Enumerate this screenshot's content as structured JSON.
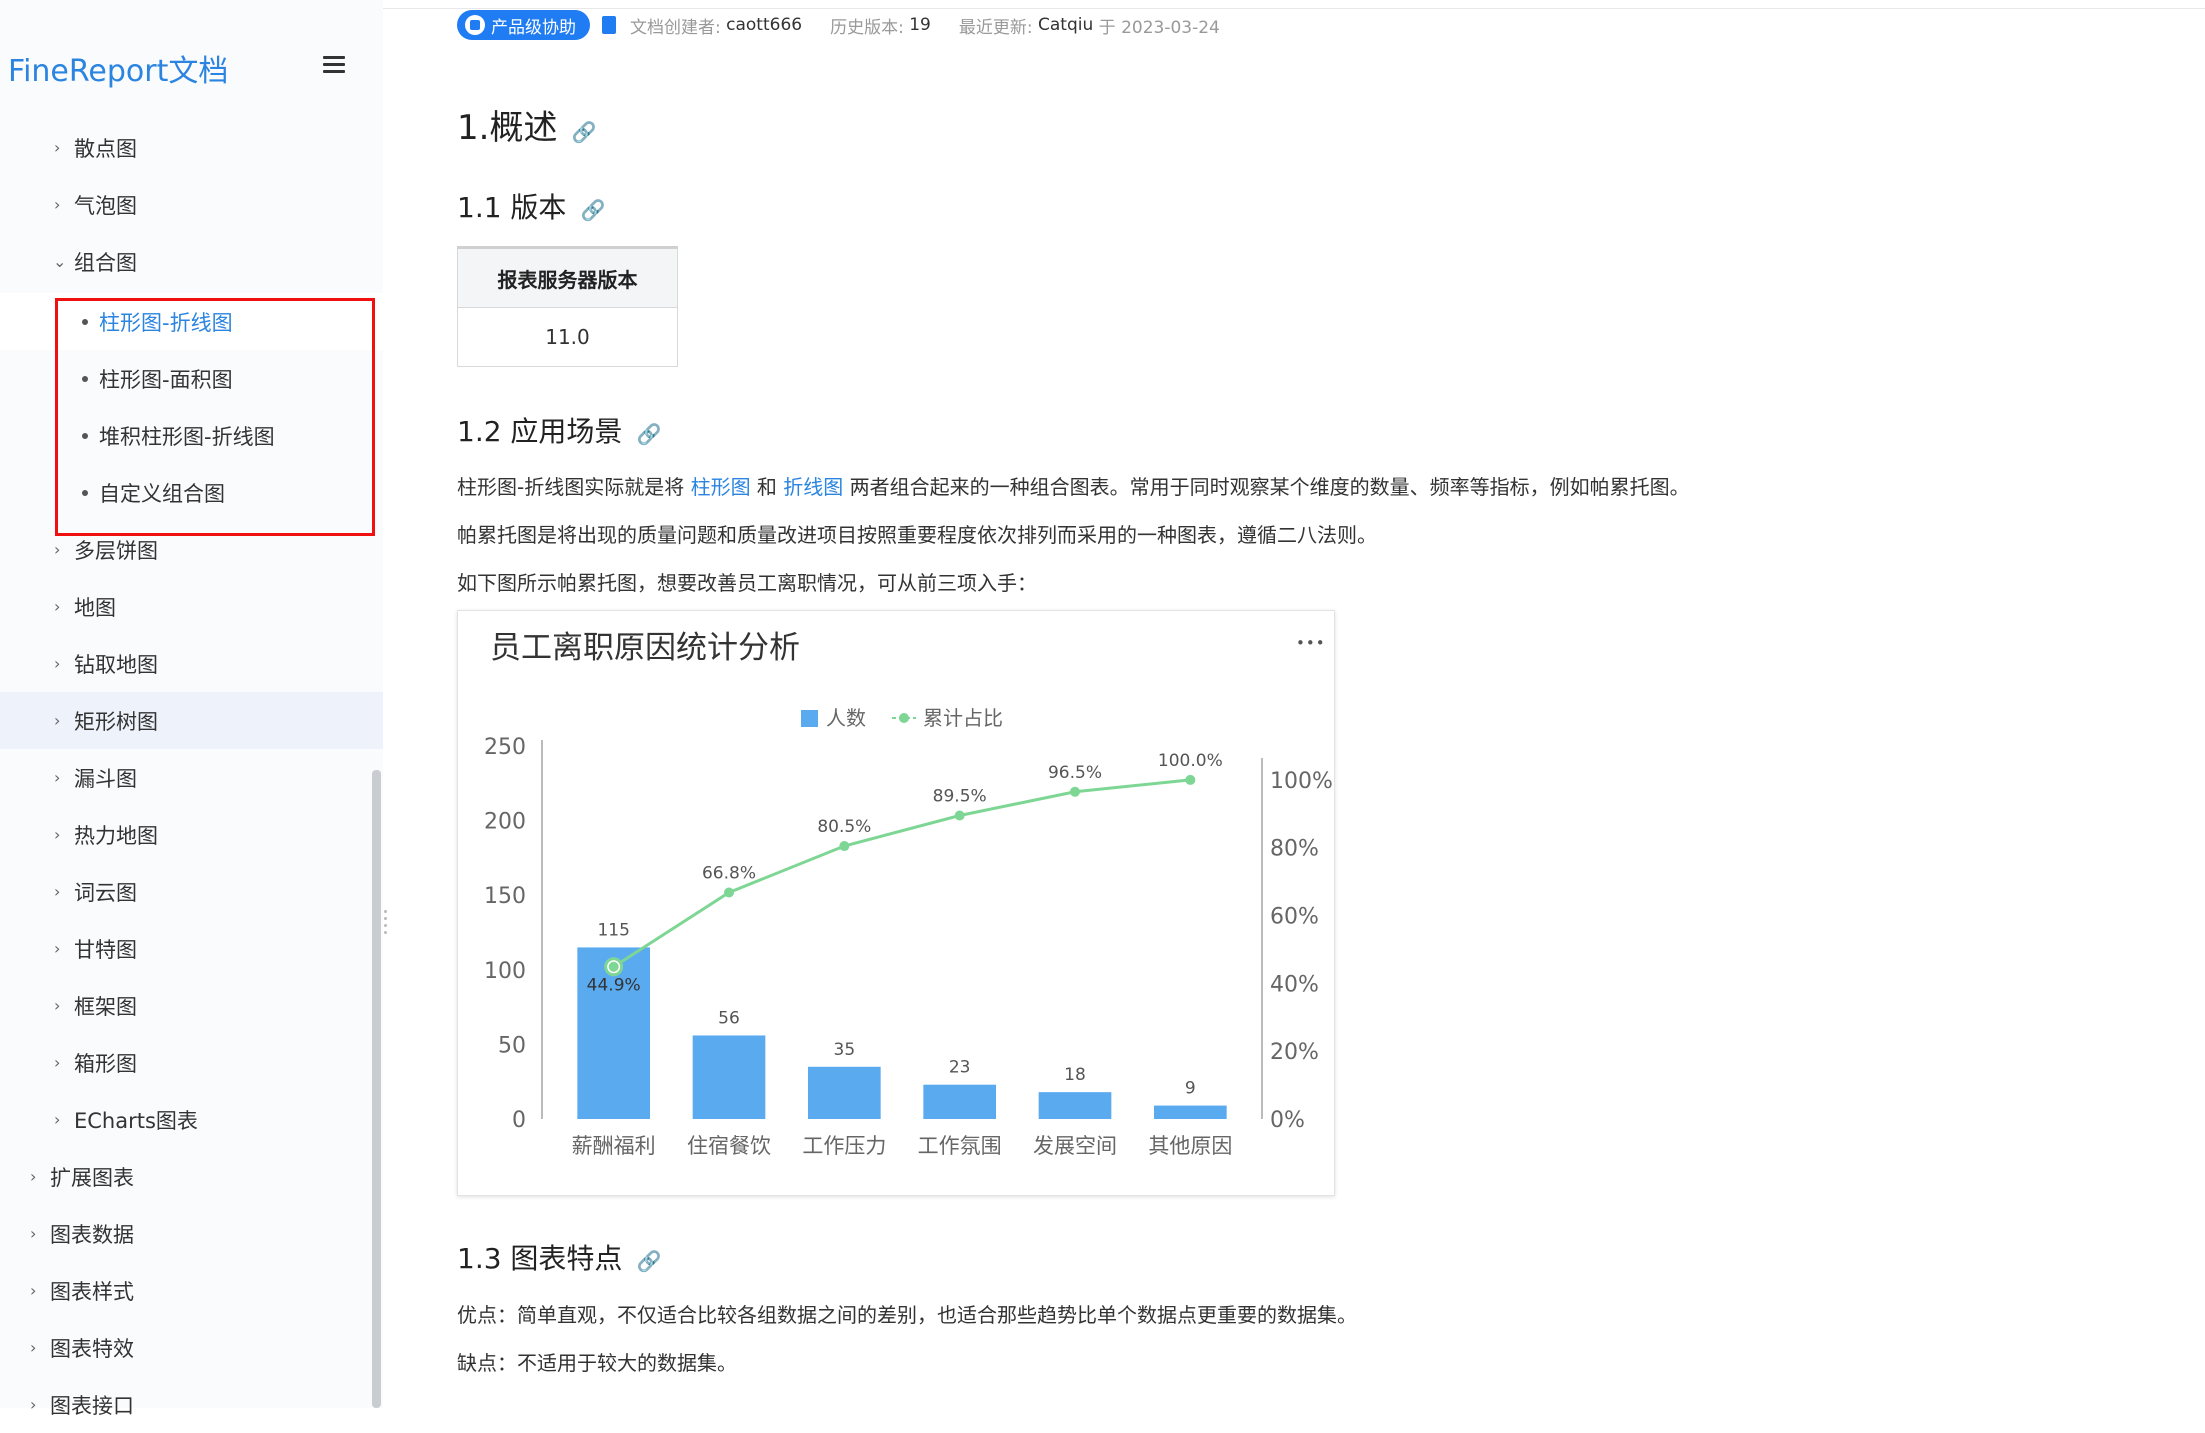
{
  "sidebar": {
    "logo": "FineReport文档",
    "items": [
      {
        "label": "散点图"
      },
      {
        "label": "气泡图"
      },
      {
        "label": "组合图"
      },
      {
        "label": "柱形图-折线图"
      },
      {
        "label": "柱形图-面积图"
      },
      {
        "label": "堆积柱形图-折线图"
      },
      {
        "label": "自定义组合图"
      },
      {
        "label": "多层饼图"
      },
      {
        "label": "地图"
      },
      {
        "label": "钻取地图"
      },
      {
        "label": "矩形树图"
      },
      {
        "label": "漏斗图"
      },
      {
        "label": "热力地图"
      },
      {
        "label": "词云图"
      },
      {
        "label": "甘特图"
      },
      {
        "label": "框架图"
      },
      {
        "label": "箱形图"
      },
      {
        "label": "ECharts图表"
      },
      {
        "label": "扩展图表"
      },
      {
        "label": "图表数据"
      },
      {
        "label": "图表样式"
      },
      {
        "label": "图表特效"
      },
      {
        "label": "图表接口"
      }
    ]
  },
  "meta": {
    "badge": "产品级协助",
    "creator_label": "文档创建者:",
    "creator": "caott666",
    "history_label": "历史版本:",
    "history": "19",
    "updated_label": "最近更新:",
    "updated_by": "Catqiu",
    "updated_on": "于 2023-03-24"
  },
  "content": {
    "h1": "1.概述",
    "h1_1": "1.1 版本",
    "table_header": "报表服务器版本",
    "table_value": "11.0",
    "h1_2": "1.2 应用场景",
    "p1_a": "柱形图-折线图实际就是将 ",
    "p1_link1": "柱形图",
    "p1_b": " 和 ",
    "p1_link2": "折线图",
    "p1_c": " 两者组合起来的一种组合图表。常用于同时观察某个维度的数量、频率等指标，例如帕累托图。",
    "p2": "帕累托图是将出现的质量问题和质量改进项目按照重要程度依次排列而采用的一种图表，遵循二八法则。",
    "p3": "如下图所示帕累托图，想要改善员工离职情况，可从前三项入手：",
    "h1_3": "1.3 图表特点",
    "p4": "优点：简单直观，不仅适合比较各组数据之间的差别，也适合那些趋势比单个数据点更重要的数据集。",
    "p5": "缺点：不适用于较大的数据集。",
    "link_icon": "link-icon"
  },
  "chart_data": {
    "type": "bar",
    "title": "员工离职原因统计分析",
    "more_glyph": "•••",
    "categories": [
      "薪酬福利",
      "住宿餐饮",
      "工作压力",
      "工作氛围",
      "发展空间",
      "其他原因"
    ],
    "series": [
      {
        "name": "人数",
        "type": "bar",
        "values": [
          115,
          56,
          35,
          23,
          18,
          9
        ],
        "color": "#5aaaf0"
      },
      {
        "name": "累计占比",
        "type": "line",
        "values": [
          44.9,
          66.8,
          80.5,
          89.5,
          96.5,
          100.0
        ],
        "labels": [
          "44.9%",
          "66.8%",
          "80.5%",
          "89.5%",
          "96.5%",
          "100.0%"
        ],
        "color": "#7dd694"
      }
    ],
    "ylim": [
      0,
      250
    ],
    "yticks": [
      "0",
      "50",
      "100",
      "150",
      "200",
      "250"
    ],
    "y2lim": [
      0,
      110
    ],
    "y2ticks": [
      "0%",
      "20%",
      "40%",
      "60%",
      "80%",
      "100%"
    ],
    "legend": "top-center"
  }
}
